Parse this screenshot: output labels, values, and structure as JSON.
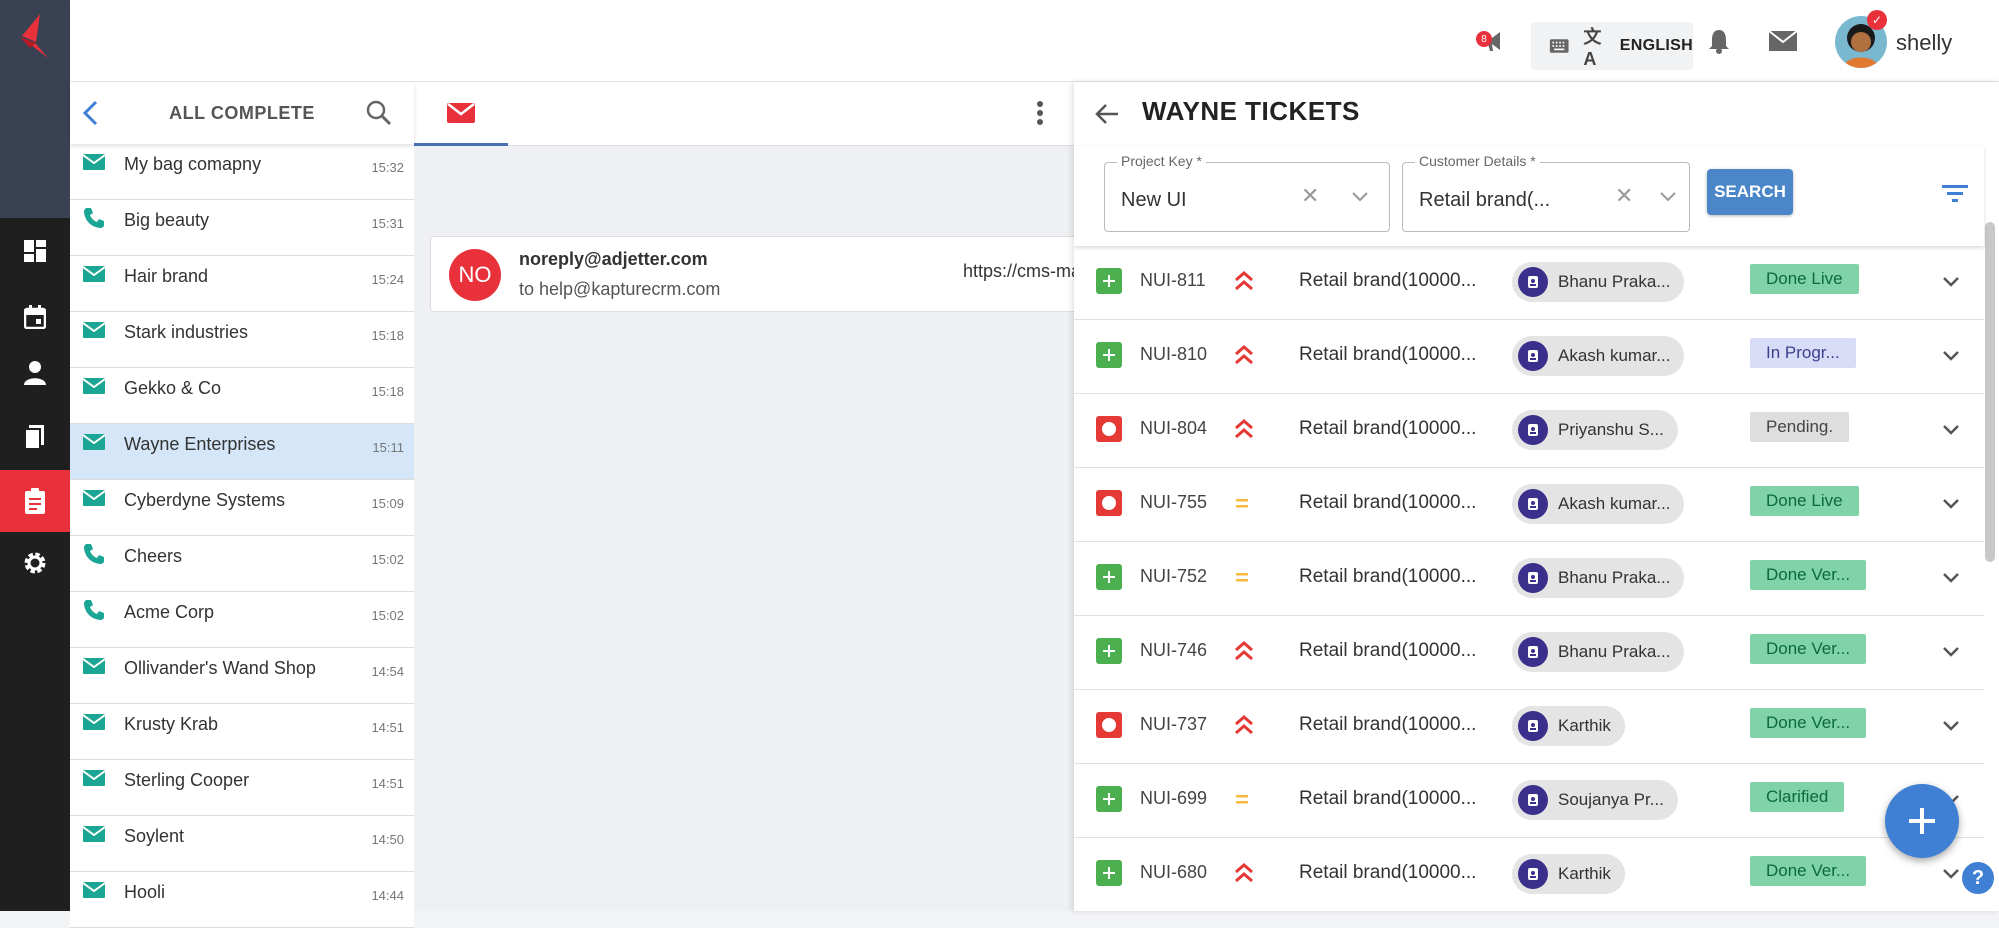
{
  "topbar": {
    "notification_count": "8",
    "language": "ENGLISH",
    "username": "shelly",
    "icons": [
      "megaphone-icon",
      "keyboard-icon",
      "translate-icon",
      "bell-icon",
      "mail-icon"
    ]
  },
  "rail": {
    "items": [
      "dashboard-icon",
      "calendar-icon",
      "person-icon",
      "folder-icon",
      "clipboard-icon",
      "gear-icon"
    ],
    "active": "clipboard-icon"
  },
  "left_panel": {
    "title": "ALL COMPLETE",
    "items": [
      {
        "name": "My bag comapny",
        "time": "15:32",
        "type": "mail"
      },
      {
        "name": "Big beauty",
        "time": "15:31",
        "type": "phone"
      },
      {
        "name": "Hair brand",
        "time": "15:24",
        "type": "mail"
      },
      {
        "name": "Stark industries",
        "time": "15:18",
        "type": "mail"
      },
      {
        "name": "Gekko & Co",
        "time": "15:18",
        "type": "mail"
      },
      {
        "name": "Wayne Enterprises",
        "time": "15:11",
        "type": "mail",
        "selected": true
      },
      {
        "name": "Cyberdyne Systems",
        "time": "15:09",
        "type": "mail"
      },
      {
        "name": "Cheers",
        "time": "15:02",
        "type": "phone"
      },
      {
        "name": "Acme Corp",
        "time": "15:02",
        "type": "phone"
      },
      {
        "name": "Ollivander's Wand Shop",
        "time": "14:54",
        "type": "mail"
      },
      {
        "name": "Krusty Krab",
        "time": "14:51",
        "type": "mail"
      },
      {
        "name": "Sterling Cooper",
        "time": "14:51",
        "type": "mail"
      },
      {
        "name": "Soylent",
        "time": "14:50",
        "type": "mail"
      },
      {
        "name": "Hooli",
        "time": "14:44",
        "type": "mail"
      }
    ]
  },
  "mail": {
    "avatar_initials": "NO",
    "from": "noreply@adjetter.com",
    "to": "to help@kapturecrm.com",
    "link": "https://cms-ma"
  },
  "right_panel": {
    "title": "WAYNE TICKETS",
    "project_key_label": "Project Key *",
    "project_key_value": "New UI",
    "customer_label": "Customer Details *",
    "customer_value": "Retail brand(...",
    "search_label": "SEARCH",
    "tickets": [
      {
        "key": "NUI-811",
        "type": "story",
        "priority": "high",
        "customer": "Retail brand(10000...",
        "assignee": "Bhanu Praka...",
        "status": "Done Live",
        "status_color": "#7fd3a6"
      },
      {
        "key": "NUI-810",
        "type": "story",
        "priority": "high",
        "customer": "Retail brand(10000...",
        "assignee": "Akash kumar...",
        "status": "In Progr...",
        "status_color": "#d9dcf7"
      },
      {
        "key": "NUI-804",
        "type": "bug",
        "priority": "high",
        "customer": "Retail brand(10000...",
        "assignee": "Priyanshu S...",
        "status": "Pending.",
        "status_color": "#dedede"
      },
      {
        "key": "NUI-755",
        "type": "bug",
        "priority": "medium",
        "customer": "Retail brand(10000...",
        "assignee": "Akash kumar...",
        "status": "Done Live",
        "status_color": "#7fd3a6"
      },
      {
        "key": "NUI-752",
        "type": "story",
        "priority": "medium",
        "customer": "Retail brand(10000...",
        "assignee": "Bhanu Praka...",
        "status": "Done Ver...",
        "status_color": "#7fd3a6"
      },
      {
        "key": "NUI-746",
        "type": "story",
        "priority": "high",
        "customer": "Retail brand(10000...",
        "assignee": "Bhanu Praka...",
        "status": "Done Ver...",
        "status_color": "#7fd3a6"
      },
      {
        "key": "NUI-737",
        "type": "bug",
        "priority": "high",
        "customer": "Retail brand(10000...",
        "assignee": "Karthik",
        "status": "Done Ver...",
        "status_color": "#7fd3a6"
      },
      {
        "key": "NUI-699",
        "type": "story",
        "priority": "medium",
        "customer": "Retail brand(10000...",
        "assignee": "Soujanya Pr...",
        "status": "Clarified",
        "status_color": "#7fd3a6"
      },
      {
        "key": "NUI-680",
        "type": "story",
        "priority": "high",
        "customer": "Retail brand(10000...",
        "assignee": "Karthik",
        "status": "Done Ver...",
        "status_color": "#7fd3a6"
      }
    ]
  },
  "colors": {
    "brand_red": "#e8313b",
    "accent_blue": "#4a86c8",
    "teal_icon": "#1aa595",
    "story_green": "#4caf50",
    "bug_red": "#e53935"
  }
}
